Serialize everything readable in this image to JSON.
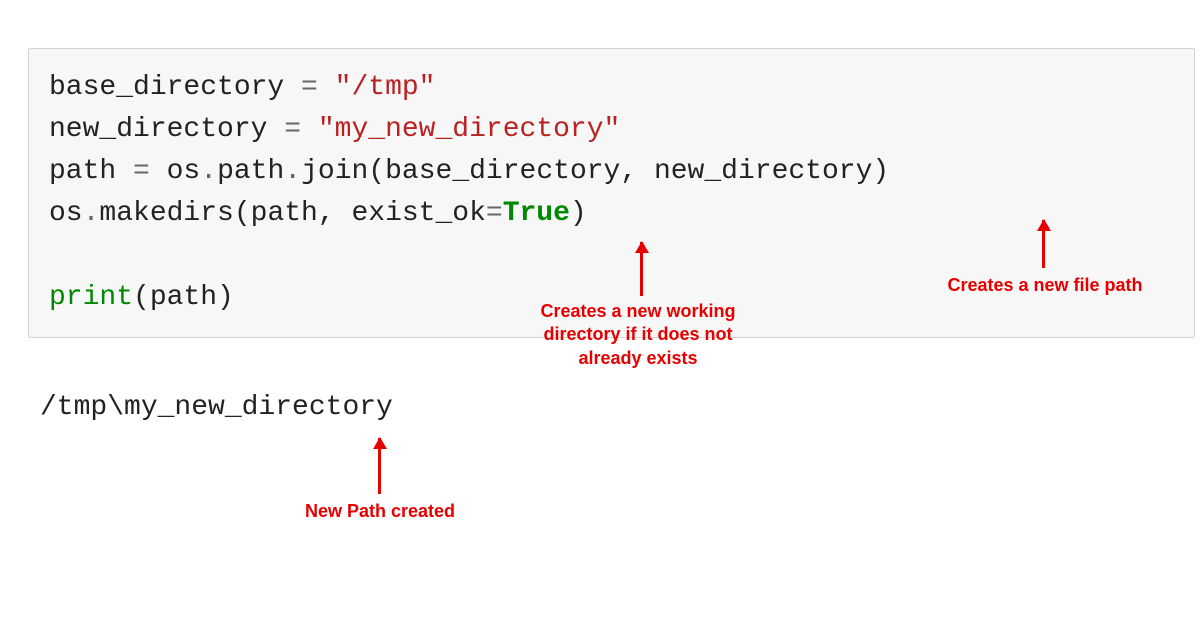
{
  "code": {
    "line1_var": "base_directory ",
    "line1_op": "=",
    "line1_str": " \"/tmp\"",
    "line2_var": "new_directory ",
    "line2_op": "=",
    "line2_str": " \"my_new_directory\"",
    "line3_a": "path ",
    "line3_op": "=",
    "line3_b": " os",
    "line3_dot1": ".",
    "line3_c": "path",
    "line3_dot2": ".",
    "line3_d": "join(base_directory, new_directory)",
    "line4_a": "os",
    "line4_dot": ".",
    "line4_b": "makedirs(path, exist_ok",
    "line4_eq": "=",
    "line4_true": "True",
    "line4_close": ")",
    "line6_print": "print",
    "line6_rest": "(path)"
  },
  "output": "/tmp\\my_new_directory",
  "annotations": {
    "makedirs": "Creates a new working directory if it does not already exists",
    "filepath": "Creates a new file path",
    "newpath": "New Path created"
  }
}
